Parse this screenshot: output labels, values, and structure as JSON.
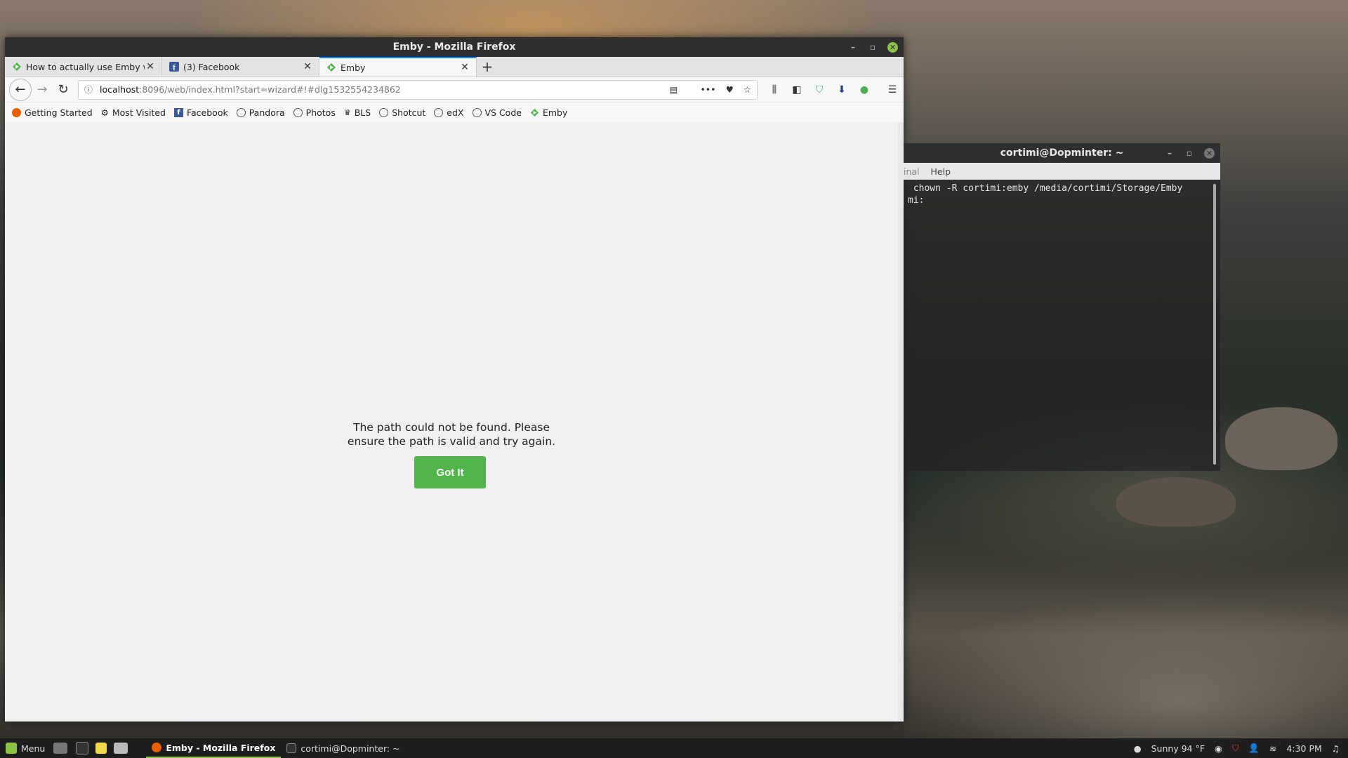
{
  "firefox": {
    "window_title": "Emby - Mozilla Firefox",
    "tabs": [
      {
        "label": "How to actually use Emby wit",
        "icon": "emby-icon"
      },
      {
        "label": "(3) Facebook",
        "icon": "facebook-icon"
      },
      {
        "label": "Emby",
        "icon": "emby-icon",
        "active": true
      }
    ],
    "url": {
      "host": "localhost",
      "rest": ":8096/web/index.html?start=wizard#!#dlg1532554234862"
    },
    "bookmarks": [
      "Getting Started",
      "Most Visited",
      "Facebook",
      "Pandora",
      "Photos",
      "BLS",
      "Shotcut",
      "edX",
      "VS Code",
      "Emby"
    ]
  },
  "dialog": {
    "message_line1": "The path could not be found. Please",
    "message_line2": "ensure the path is valid and try again.",
    "button_label": "Got It"
  },
  "terminal": {
    "window_title": "cortimi@Dopminter: ~",
    "menu": [
      "inal",
      "Help"
    ],
    "lines": [
      " chown -R cortimi:emby /media/cortimi/Storage/Emby",
      "mi:"
    ]
  },
  "panel": {
    "menu_label": "Menu",
    "tasks": [
      "Emby - Mozilla Firefox",
      "cortimi@Dopminter: ~"
    ],
    "weather": "Sunny 94 °F",
    "clock": "4:30 PM"
  },
  "colors": {
    "accent_green": "#52b54b",
    "tab_active_border": "#0a84ff"
  }
}
